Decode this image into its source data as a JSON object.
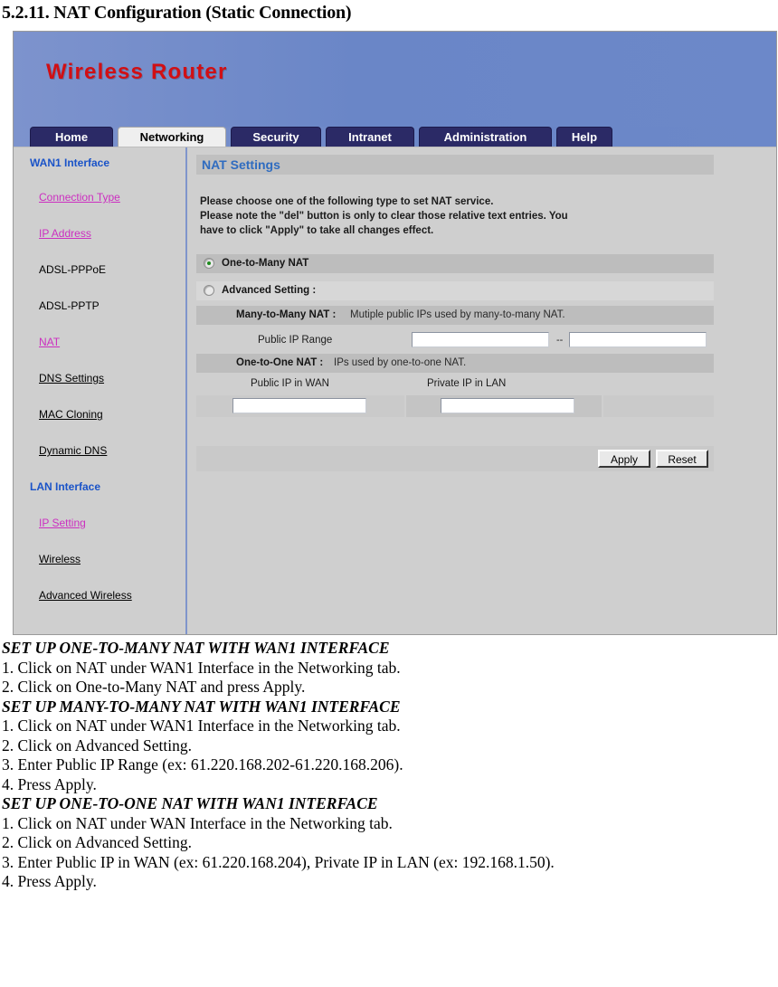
{
  "document": {
    "section_title": "5.2.11. NAT Configuration (Static Connection)"
  },
  "router_ui": {
    "brand": "Wireless Router",
    "tabs": [
      {
        "label": "Home",
        "active": false
      },
      {
        "label": "Networking",
        "active": true
      },
      {
        "label": "Security",
        "active": false
      },
      {
        "label": "Intranet",
        "active": false
      },
      {
        "label": "Administration",
        "active": false
      },
      {
        "label": "Help",
        "active": false
      }
    ],
    "sidebar": {
      "group1_title": "WAN1 Interface",
      "group1_items": [
        {
          "label": "Connection Type",
          "style": "pink"
        },
        {
          "label": "IP Address",
          "style": "pink"
        },
        {
          "label": "ADSL-PPPoE",
          "style": "plain"
        },
        {
          "label": "ADSL-PPTP",
          "style": "plain"
        },
        {
          "label": "NAT",
          "style": "pink"
        },
        {
          "label": "DNS Settings",
          "style": "black"
        },
        {
          "label": "MAC Cloning",
          "style": "black"
        },
        {
          "label": "Dynamic DNS",
          "style": "black"
        }
      ],
      "group2_title": "LAN Interface",
      "group2_items": [
        {
          "label": "IP Setting",
          "style": "pink"
        },
        {
          "label": "Wireless",
          "style": "black"
        },
        {
          "label": "Advanced Wireless",
          "style": "black"
        }
      ]
    },
    "panel": {
      "heading": "NAT Settings",
      "intro_line1": "Please choose one of the following type to set NAT service.",
      "intro_line2": "Please note the \"del\" button is only to clear those relative text entries. You",
      "intro_line3": "have to click \"Apply\" to take all changes effect.",
      "option_one_to_many": "One-to-Many NAT",
      "option_one_to_many_selected": true,
      "option_advanced": "Advanced Setting :",
      "option_advanced_selected": false,
      "many_to_many_title": "Many-to-Many NAT :",
      "many_to_many_desc": "Mutiple public IPs used by many-to-many NAT.",
      "public_ip_range_label": "Public IP Range",
      "public_ip_range_start": "",
      "public_ip_range_end": "",
      "range_separator": "--",
      "one_to_one_title": "One-to-One NAT :",
      "one_to_one_desc": "IPs used by one-to-one NAT.",
      "public_ip_wan_label": "Public IP in WAN",
      "private_ip_lan_label": "Private IP in LAN",
      "public_ip_wan_value": "",
      "private_ip_lan_value": "",
      "apply_label": "Apply",
      "reset_label": "Reset"
    },
    "colors": {
      "banner_blue": "#6b88c8",
      "tab_navy": "#2b2a66",
      "brand_red": "#d10f14",
      "heading_blue": "#2f6cc0",
      "sidebar_head_blue": "#1a53c8",
      "link_pink": "#cc2fc0",
      "radio_green": "#1e8b1e",
      "panel_gray": "#cfcfcf"
    }
  },
  "instructions": [
    {
      "type": "head",
      "text": "SET UP ONE-TO-MANY NAT WITH WAN1 INTERFACE"
    },
    {
      "type": "item",
      "text": "1. Click on NAT under WAN1 Interface in the Networking tab."
    },
    {
      "type": "item",
      "text": "2. Click on One-to-Many NAT and press Apply."
    },
    {
      "type": "head",
      "text": "SET UP MANY-TO-MANY NAT WITH WAN1 INTERFACE"
    },
    {
      "type": "item",
      "text": "1. Click on NAT under WAN1 Interface in the Networking tab."
    },
    {
      "type": "item",
      "text": "2. Click on Advanced Setting."
    },
    {
      "type": "item",
      "text": "3. Enter Public IP Range (ex: 61.220.168.202-61.220.168.206)."
    },
    {
      "type": "item",
      "text": "4. Press Apply."
    },
    {
      "type": "head",
      "text": "SET UP ONE-TO-ONE NAT WITH WAN1 INTERFACE"
    },
    {
      "type": "item",
      "text": "1. Click on NAT under WAN Interface in the Networking tab."
    },
    {
      "type": "item",
      "text": "2. Click on Advanced Setting."
    },
    {
      "type": "item",
      "text": "3. Enter Public IP in WAN (ex: 61.220.168.204), Private IP in LAN (ex: 192.168.1.50)."
    },
    {
      "type": "item",
      "text": "4. Press Apply."
    }
  ]
}
